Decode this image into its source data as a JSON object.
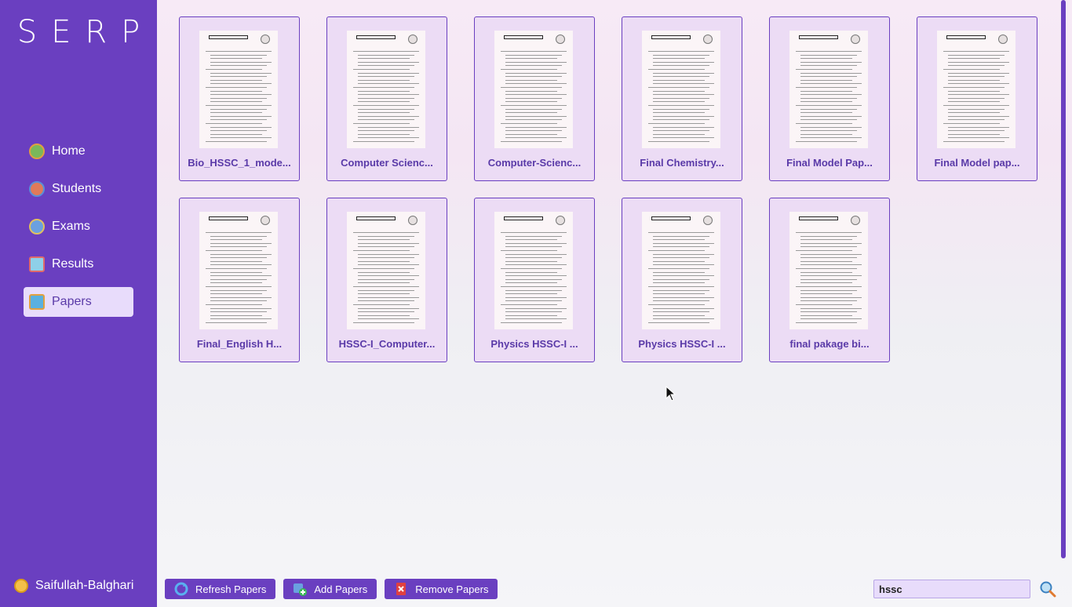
{
  "app": {
    "logo": "SERP"
  },
  "sidebar": {
    "items": [
      {
        "label": "Home",
        "icon": "home-icon"
      },
      {
        "label": "Students",
        "icon": "students-icon"
      },
      {
        "label": "Exams",
        "icon": "exams-icon"
      },
      {
        "label": "Results",
        "icon": "results-icon"
      },
      {
        "label": "Papers",
        "icon": "papers-icon",
        "active": true
      }
    ],
    "user": "Saifullah-Balghari"
  },
  "papers": [
    {
      "label": "Bio_HSSC_1_mode..."
    },
    {
      "label": "Computer Scienc..."
    },
    {
      "label": "Computer-Scienc..."
    },
    {
      "label": "Final Chemistry..."
    },
    {
      "label": "Final Model Pap..."
    },
    {
      "label": "Final Model pap..."
    },
    {
      "label": "Final_English H..."
    },
    {
      "label": "HSSC-I_Computer..."
    },
    {
      "label": "Physics HSSC-I ..."
    },
    {
      "label": "Physics HSSC-I ..."
    },
    {
      "label": "final pakage bi..."
    }
  ],
  "toolbar": {
    "refresh_label": "Refresh Papers",
    "add_label": "Add Papers",
    "remove_label": "Remove Papers"
  },
  "search": {
    "value": "hssc"
  },
  "colors": {
    "sidebar": "#6a3fc0",
    "accent": "#5a3aa8",
    "card": "#ecdcf5"
  }
}
